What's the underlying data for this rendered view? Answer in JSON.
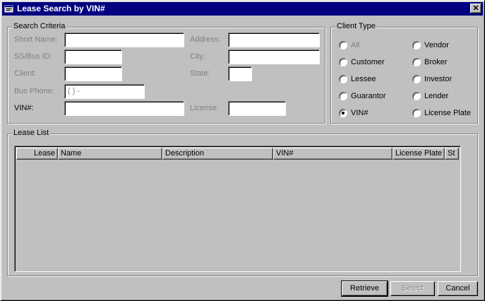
{
  "window": {
    "title": "Lease Search by VIN#",
    "close_label": "✕"
  },
  "search_criteria": {
    "legend": "Search Criteria",
    "short_name_label": "Short Name:",
    "ss_bus_id_label": "SS/Bus ID:",
    "client_label": "Client:",
    "bus_phone_label": "Bus Phone:",
    "bus_phone_value": "(   )    -",
    "vin_label": "VIN#:",
    "address_label": "Address:",
    "city_label": "City:",
    "state_label": "State:",
    "license_label": "License:"
  },
  "client_type": {
    "legend": "Client Type",
    "options": [
      {
        "label": "All",
        "selected": false,
        "disabled": true
      },
      {
        "label": "Customer",
        "selected": false,
        "disabled": false
      },
      {
        "label": "Lessee",
        "selected": false,
        "disabled": false
      },
      {
        "label": "Guarantor",
        "selected": false,
        "disabled": false
      },
      {
        "label": "VIN#",
        "selected": true,
        "disabled": false
      },
      {
        "label": "Vendor",
        "selected": false,
        "disabled": false
      },
      {
        "label": "Broker",
        "selected": false,
        "disabled": false
      },
      {
        "label": "Investor",
        "selected": false,
        "disabled": false
      },
      {
        "label": "Lender",
        "selected": false,
        "disabled": false
      },
      {
        "label": "License Plate",
        "selected": false,
        "disabled": false
      }
    ]
  },
  "lease_list": {
    "legend": "Lease List",
    "columns": [
      "Lease",
      "Name",
      "Description",
      "VIN#",
      "License Plate",
      "St"
    ],
    "rows": []
  },
  "buttons": {
    "retrieve": "Retrieve",
    "select": "Select",
    "cancel": "Cancel"
  },
  "colors": {
    "title_bar": "#000080",
    "face": "#c0c0c0",
    "disabled_text": "#808080"
  }
}
